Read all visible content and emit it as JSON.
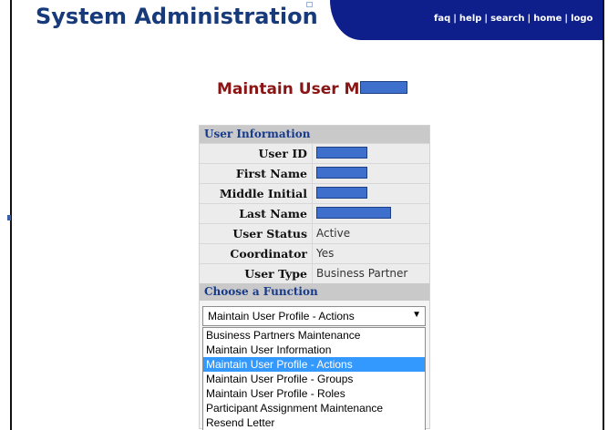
{
  "header": {
    "app_title": "System Administration",
    "links": [
      "faq",
      "help",
      "search",
      "home",
      "logo"
    ],
    "separator": "|",
    "nav_color": "#0e1f8c"
  },
  "page": {
    "heading": "Maintain User M"
  },
  "user_information": {
    "section_title": "User Information",
    "rows": [
      {
        "label": "User ID",
        "value": "",
        "redacted": true
      },
      {
        "label": "First Name",
        "value": "",
        "redacted": true
      },
      {
        "label": "Middle Initial",
        "value": "",
        "redacted": true
      },
      {
        "label": "Last Name",
        "value": "",
        "redacted": true
      },
      {
        "label": "User Status",
        "value": "Active",
        "redacted": false
      },
      {
        "label": "Coordinator",
        "value": "Yes",
        "redacted": false
      },
      {
        "label": "User Type",
        "value": "Business Partner",
        "redacted": false
      }
    ]
  },
  "function_chooser": {
    "section_title": "Choose a Function",
    "selected": "Maintain User Profile - Actions",
    "options": [
      "Business Partners Maintenance",
      "Maintain User Information",
      "Maintain User Profile - Actions",
      "Maintain User Profile - Groups",
      "Maintain User Profile - Roles",
      "Participant Assignment Maintenance",
      "Resend Letter"
    ],
    "highlighted_index": 2,
    "highlight_color": "#3399ff"
  },
  "colors": {
    "title": "#173a7a",
    "heading": "#8b1414",
    "section_header_text": "#173a8a",
    "redaction": "#3f6fcc"
  }
}
